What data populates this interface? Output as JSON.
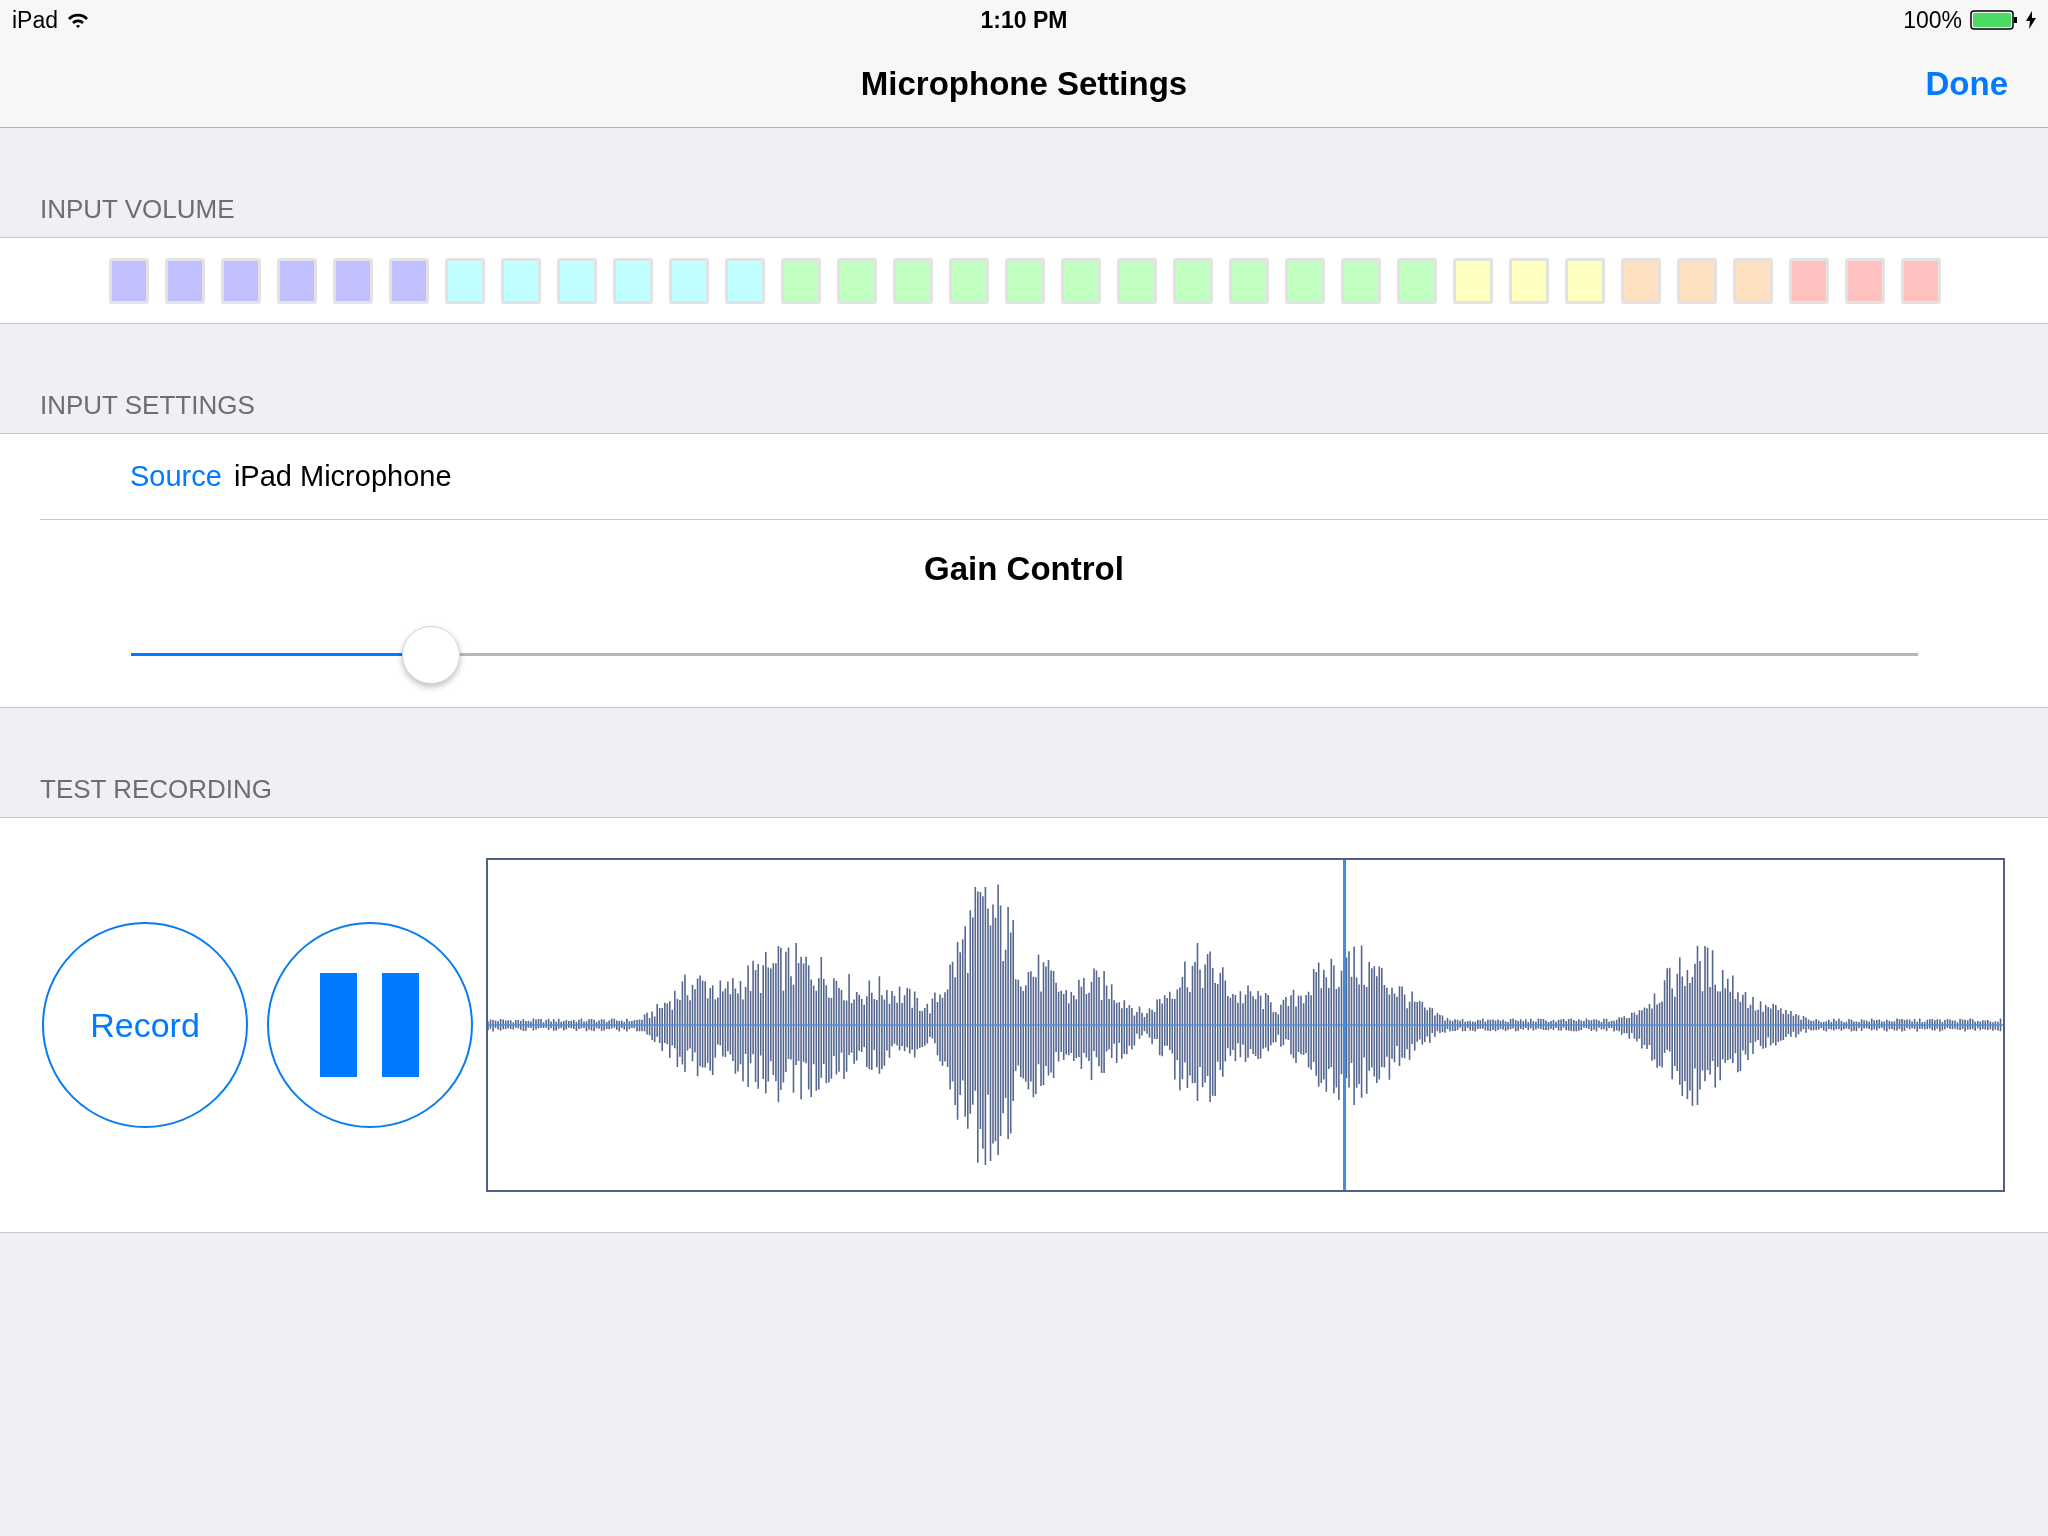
{
  "status_bar": {
    "device": "iPad",
    "time": "1:10 PM",
    "battery": "100%"
  },
  "nav_bar": {
    "title": "Microphone Settings",
    "done": "Done"
  },
  "input_volume": {
    "header": "INPUT VOLUME",
    "segments": [
      {
        "color": "#c0c0ff"
      },
      {
        "color": "#c0c0ff"
      },
      {
        "color": "#c0c0ff"
      },
      {
        "color": "#c0c0ff"
      },
      {
        "color": "#c0c0ff"
      },
      {
        "color": "#c0c0ff"
      },
      {
        "color": "#c0ffff"
      },
      {
        "color": "#c0ffff"
      },
      {
        "color": "#c0ffff"
      },
      {
        "color": "#c0ffff"
      },
      {
        "color": "#c0ffff"
      },
      {
        "color": "#c0ffff"
      },
      {
        "color": "#c0ffc0"
      },
      {
        "color": "#c0ffc0"
      },
      {
        "color": "#c0ffc0"
      },
      {
        "color": "#c0ffc0"
      },
      {
        "color": "#c0ffc0"
      },
      {
        "color": "#c0ffc0"
      },
      {
        "color": "#c0ffc0"
      },
      {
        "color": "#c0ffc0"
      },
      {
        "color": "#c0ffc0"
      },
      {
        "color": "#c0ffc0"
      },
      {
        "color": "#c0ffc0"
      },
      {
        "color": "#c0ffc0"
      },
      {
        "color": "#ffffc0"
      },
      {
        "color": "#ffffc0"
      },
      {
        "color": "#ffffc0"
      },
      {
        "color": "#ffe0c0"
      },
      {
        "color": "#ffe0c0"
      },
      {
        "color": "#ffe0c0"
      },
      {
        "color": "#ffc0c0"
      },
      {
        "color": "#ffc0c0"
      },
      {
        "color": "#ffc0c0"
      }
    ]
  },
  "input_settings": {
    "header": "INPUT SETTINGS",
    "source_label": "Source",
    "source_value": "iPad Microphone",
    "gain_title": "Gain Control",
    "gain": {
      "level": 0.168
    }
  },
  "test_recording": {
    "header": "TEST RECORDING",
    "record": "Record",
    "waveform": {
      "level": 0.565
    }
  }
}
